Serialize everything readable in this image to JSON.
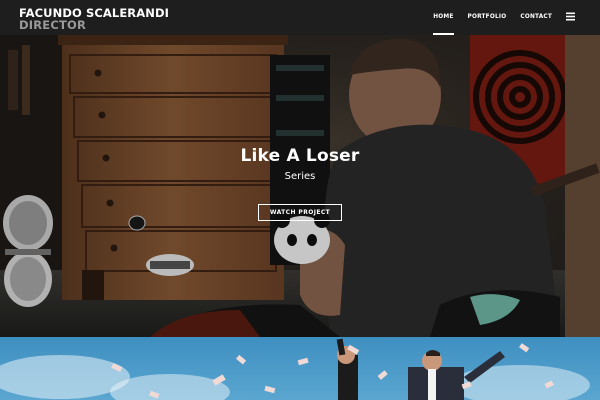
{
  "brand": {
    "name": "FACUNDO SCALERANDI",
    "role": "DIRECTOR"
  },
  "nav": {
    "home": "HOME",
    "portfolio": "PORTFOLIO",
    "contact": "CONTACT",
    "menu_icon": "hamburger-menu-icon"
  },
  "hero": {
    "title": "Like A Loser",
    "subtitle": "Series",
    "button": "WATCH PROJECT"
  },
  "colors": {
    "topbar": "#1e1e1e",
    "brand_name": "#ffffff",
    "brand_role": "#9a9a9a",
    "nav_text": "#ffffff"
  }
}
